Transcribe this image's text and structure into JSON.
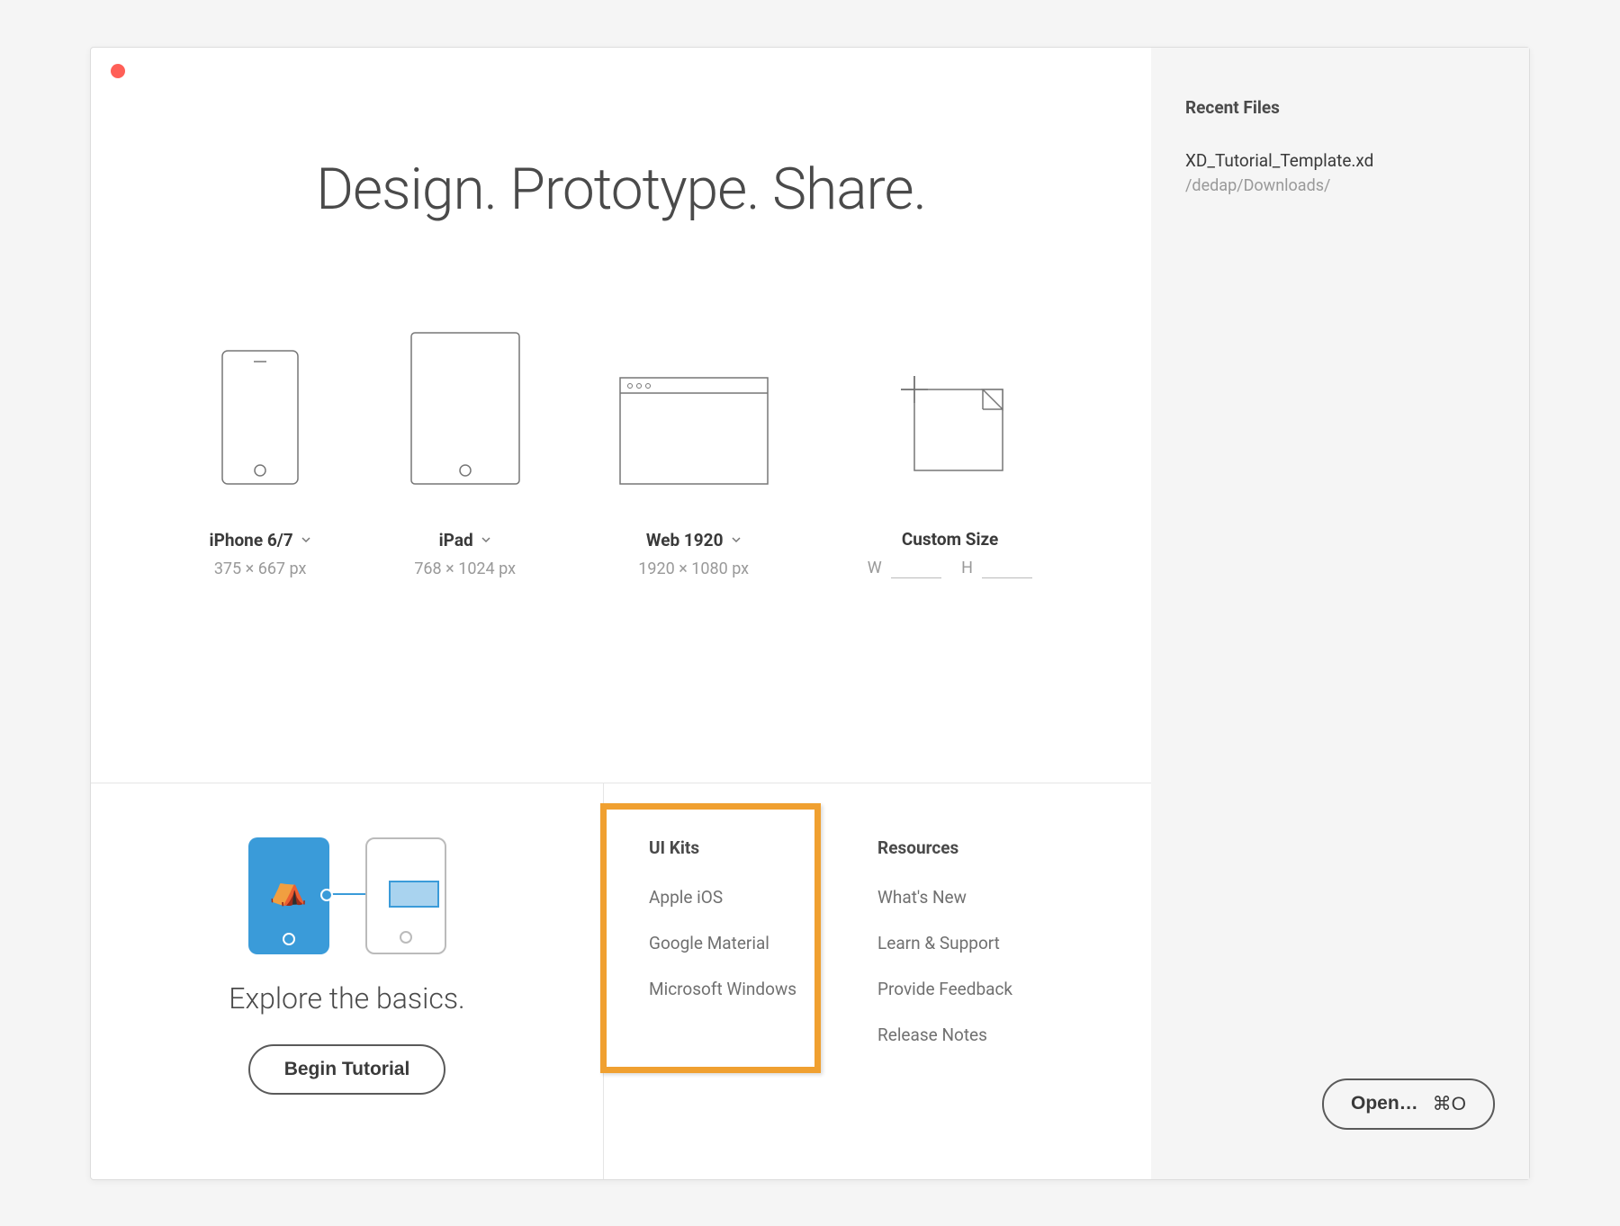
{
  "hero": {
    "title": "Design. Prototype. Share."
  },
  "presets": [
    {
      "label": "iPhone 6/7",
      "dimensions": "375 × 667 px"
    },
    {
      "label": "iPad",
      "dimensions": "768 × 1024 px"
    },
    {
      "label": "Web 1920",
      "dimensions": "1920 × 1080 px"
    }
  ],
  "custom": {
    "label": "Custom Size",
    "w_label": "W",
    "h_label": "H"
  },
  "tutorial": {
    "title": "Explore the basics.",
    "button": "Begin Tutorial"
  },
  "uikits": {
    "header": "UI Kits",
    "items": [
      "Apple iOS",
      "Google Material",
      "Microsoft Windows"
    ]
  },
  "resources": {
    "header": "Resources",
    "items": [
      "What's New",
      "Learn & Support",
      "Provide Feedback",
      "Release Notes"
    ]
  },
  "sidebar": {
    "header": "Recent Files",
    "recent": [
      {
        "name": "XD_Tutorial_Template.xd",
        "path": "/dedap/Downloads/"
      }
    ],
    "open_label": "Open…",
    "open_shortcut": "⌘O"
  }
}
